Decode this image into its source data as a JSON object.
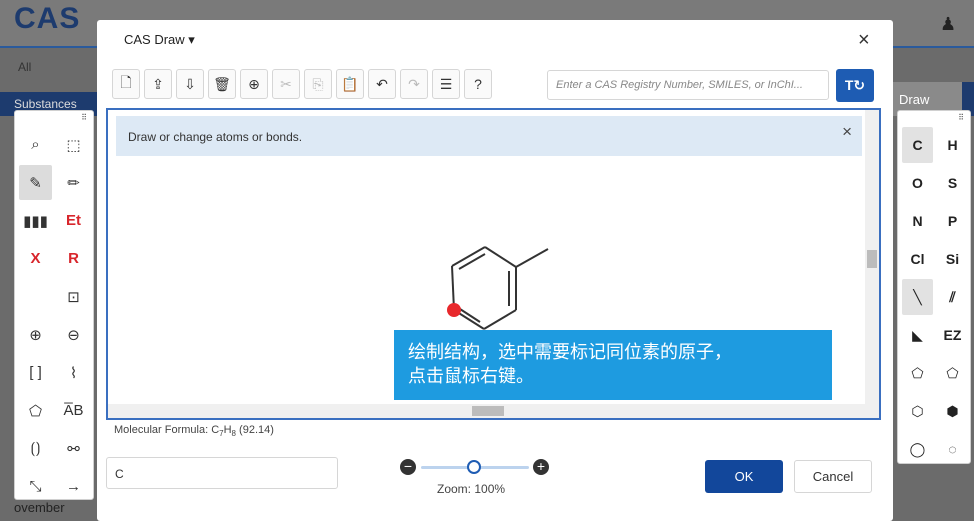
{
  "background": {
    "logo": "CAS",
    "tab_all": "All",
    "tab_substances": "Substances",
    "draw_label": "Draw",
    "bottom_text": "ovember"
  },
  "dialog": {
    "title_tab": "CAS Draw ▾",
    "close_glyph": "×",
    "toolbar": {
      "buttons": [
        "new-document",
        "import",
        "export",
        "clear",
        "center",
        "cut",
        "copy",
        "paste",
        "undo",
        "redo",
        "settings",
        "help"
      ],
      "glyphs": [
        "🗋",
        "⇪",
        "⇩",
        "🗑",
        "⊕",
        "✂",
        "⎘",
        "📋",
        "↶",
        "↷",
        "☰",
        "?"
      ]
    },
    "search": {
      "placeholder": "Enter a CAS Registry Number, SMILES, or InChI...",
      "go_label": "T↻"
    },
    "info_message": "Draw or change atoms or bonds.",
    "info_close": "×",
    "tooltip_line1": "绘制结构，选中需要标记同位素的原子，",
    "tooltip_line2": "点击鼠标右键。",
    "formula_prefix": "Molecular Formula: C",
    "formula_c_count": "7",
    "formula_h": "H",
    "formula_h_count": "8",
    "formula_mass": " (92.14)",
    "text_input_value": "C",
    "zoom_label": "Zoom: 100%",
    "zoom_level_percent": 100,
    "ok_label": "OK",
    "cancel_label": "Cancel"
  },
  "left_palette": {
    "items": [
      {
        "name": "lasso-tool",
        "glyph": "⌕"
      },
      {
        "name": "marquee-tool",
        "glyph": "⬚"
      },
      {
        "name": "pencil-tool",
        "glyph": "✎"
      },
      {
        "name": "draw-bond-tool",
        "glyph": "✏"
      },
      {
        "name": "chain-tool",
        "glyph": "▮▮▮"
      },
      {
        "name": "ethyl-tool",
        "glyph": "Et"
      },
      {
        "name": "erase-tool",
        "glyph": "X"
      },
      {
        "name": "rgroup-tool",
        "glyph": "R"
      },
      {
        "name": "empty",
        "glyph": ""
      },
      {
        "name": "ring-tool",
        "glyph": "⊡"
      },
      {
        "name": "plus-charge-tool",
        "glyph": "⊕"
      },
      {
        "name": "minus-charge-tool",
        "glyph": "⊖"
      },
      {
        "name": "bracket-tool",
        "glyph": "[ ]"
      },
      {
        "name": "chain-draw-tool",
        "glyph": "⌇"
      },
      {
        "name": "shape-tool",
        "glyph": "⬠"
      },
      {
        "name": "text-tool",
        "glyph": "A̅B"
      },
      {
        "name": "sgroup-tool",
        "glyph": "⟮⟯"
      },
      {
        "name": "bond-style-tool",
        "glyph": "⚯"
      },
      {
        "name": "arrow-diag-tool",
        "glyph": "⤡"
      },
      {
        "name": "arrow-tool",
        "glyph": "→"
      }
    ]
  },
  "right_palette": {
    "items": [
      {
        "name": "atom-c",
        "glyph": "C"
      },
      {
        "name": "atom-h",
        "glyph": "H"
      },
      {
        "name": "atom-o",
        "glyph": "O"
      },
      {
        "name": "atom-s",
        "glyph": "S"
      },
      {
        "name": "atom-n",
        "glyph": "N"
      },
      {
        "name": "atom-p",
        "glyph": "P"
      },
      {
        "name": "atom-cl",
        "glyph": "Cl"
      },
      {
        "name": "atom-si",
        "glyph": "Si"
      },
      {
        "name": "single-bond",
        "glyph": "╲"
      },
      {
        "name": "double-bond",
        "glyph": "⫽"
      },
      {
        "name": "wedge-bond",
        "glyph": "◣"
      },
      {
        "name": "ez-bond",
        "glyph": "EZ"
      },
      {
        "name": "pentagon-ring",
        "glyph": "⬠"
      },
      {
        "name": "pentagon-aromatic-ring",
        "glyph": "⬠"
      },
      {
        "name": "hexagon-ring",
        "glyph": "⬡"
      },
      {
        "name": "hexagon-aromatic-ring",
        "glyph": "⬢"
      },
      {
        "name": "heptagon-ring",
        "glyph": "◯"
      },
      {
        "name": "custom-ring",
        "glyph": "◌"
      }
    ]
  },
  "colors": {
    "accent": "#1e5cb3",
    "tooltip_bg": "#1e9be0",
    "ok_bg": "#12479b",
    "selected_atom": "#e8282c"
  }
}
